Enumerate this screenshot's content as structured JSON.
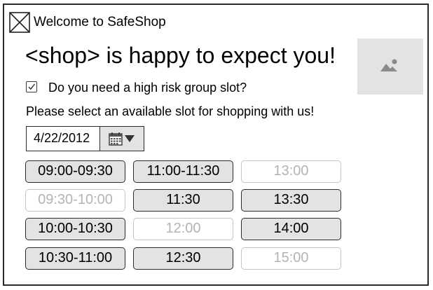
{
  "app_title": "Welcome to SafeShop",
  "headline": "<shop> is happy to expect you!",
  "logo_icon": "logo-placeholder-icon",
  "image_icon": "image-placeholder-icon",
  "high_risk": {
    "label": "Do you need a high risk group slot?",
    "checked": true
  },
  "instructions": "Please select an available slot for shopping with us!",
  "date_picker": {
    "value": "4/22/2012",
    "icon": "calendar-icon"
  },
  "slots": [
    {
      "label": "09:00-09:30",
      "available": true
    },
    {
      "label": "11:00-11:30",
      "available": true
    },
    {
      "label": "13:00",
      "available": false
    },
    {
      "label": "09:30-10:00",
      "available": false
    },
    {
      "label": "11:30",
      "available": true
    },
    {
      "label": "13:30",
      "available": true
    },
    {
      "label": "10:00-10:30",
      "available": true
    },
    {
      "label": "12:00",
      "available": false
    },
    {
      "label": "14:00",
      "available": true
    },
    {
      "label": "10:30-11:00",
      "available": true
    },
    {
      "label": "12:30",
      "available": true
    },
    {
      "label": "15:00",
      "available": false
    }
  ]
}
